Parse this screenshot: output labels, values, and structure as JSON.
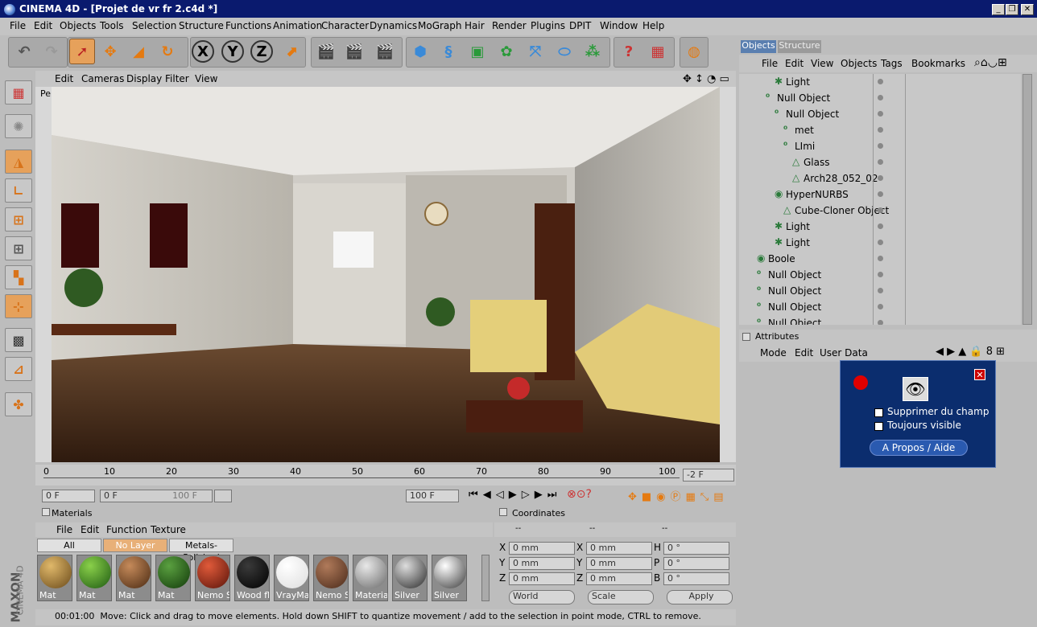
{
  "window": {
    "title": "CINEMA 4D - [Projet de vr fr 2.c4d *]",
    "minimize": "_",
    "restore": "❐",
    "close": "✕"
  },
  "menu": [
    "File",
    "Edit",
    "Objects",
    "Tools",
    "Selection",
    "Structure",
    "Functions",
    "Animation",
    "Character",
    "Dynamics",
    "MoGraph",
    "Hair",
    "Render",
    "Plugins",
    "DPIT",
    "Window",
    "Help"
  ],
  "toolbar": {
    "axis_x": "X",
    "axis_y": "Y",
    "axis_z": "Z"
  },
  "viewport": {
    "menu": [
      "Edit",
      "Cameras",
      "Display",
      "Filter",
      "View"
    ],
    "label": "Pe"
  },
  "timeline": {
    "ticks": [
      "0",
      "10",
      "20",
      "30",
      "40",
      "50",
      "60",
      "70",
      "80",
      "90",
      "100"
    ],
    "current_frame": "-2 F"
  },
  "transport": {
    "start": "0 F",
    "range_start": "0 F",
    "range_end": "100 F",
    "end": "100 F"
  },
  "materials": {
    "title": "Materials",
    "menu": [
      "File",
      "Edit",
      "Function",
      "Texture"
    ],
    "tabs": [
      "All",
      "No Layer",
      "Metals-Polished"
    ],
    "items": [
      {
        "name": "Mat",
        "c1": "#e0b86a",
        "c2": "#6a4a1a"
      },
      {
        "name": "Mat",
        "c1": "#8ad04a",
        "c2": "#1e5a12"
      },
      {
        "name": "Mat",
        "c1": "#c58a5a",
        "c2": "#4a2a12"
      },
      {
        "name": "Mat",
        "c1": "#5aa040",
        "c2": "#123a0a"
      },
      {
        "name": "Nemo Sy",
        "c1": "#e05a3a",
        "c2": "#5a140a"
      },
      {
        "name": "Wood flo",
        "c1": "#3a3a3a",
        "c2": "#000000"
      },
      {
        "name": "VrayMate",
        "c1": "#ffffff",
        "c2": "#dddddd"
      },
      {
        "name": "Nemo Sy",
        "c1": "#b07a5a",
        "c2": "#4a2a1a"
      },
      {
        "name": "Material",
        "c1": "#e8e8e8",
        "c2": "#6a6a6a"
      },
      {
        "name": "Silver",
        "c1": "#dddddd",
        "c2": "#2a2a2a"
      },
      {
        "name": "Silver",
        "c1": "#ffffff",
        "c2": "#3a3a3a"
      }
    ]
  },
  "coordinates": {
    "title": "Coordinates",
    "headers": [
      "--",
      "--",
      "--"
    ],
    "rows": [
      [
        "X",
        "0 mm",
        "X",
        "0 mm",
        "H",
        "0 °"
      ],
      [
        "Y",
        "0 mm",
        "Y",
        "0 mm",
        "P",
        "0 °"
      ],
      [
        "Z",
        "0 mm",
        "Z",
        "0 mm",
        "B",
        "0 °"
      ]
    ],
    "world": "World",
    "scale": "Scale",
    "apply": "Apply"
  },
  "status": {
    "time": "00:01:00",
    "text": "Move: Click and drag to move elements. Hold down SHIFT to quantize movement / add to the selection in point mode, CTRL to remove."
  },
  "branding": {
    "maxon": "MAXON",
    "c4d": "CINEMA 4D"
  },
  "objects_panel": {
    "tabs": [
      "Objects",
      "Structure"
    ],
    "menu": [
      "File",
      "Edit",
      "View",
      "Objects",
      "Tags",
      "Bookmarks"
    ],
    "rows": [
      {
        "name": "Light",
        "indent": 2,
        "icon": "✱"
      },
      {
        "name": "Null Object",
        "indent": 1,
        "icon": "⁰"
      },
      {
        "name": "Null Object",
        "indent": 2,
        "icon": "⁰"
      },
      {
        "name": "met",
        "indent": 3,
        "icon": "⁰"
      },
      {
        "name": "LImi",
        "indent": 3,
        "icon": "⁰"
      },
      {
        "name": "Glass",
        "indent": 4,
        "icon": "△"
      },
      {
        "name": "Arch28_052_02",
        "indent": 4,
        "icon": "△"
      },
      {
        "name": "HyperNURBS",
        "indent": 2,
        "icon": "◉"
      },
      {
        "name": "Cube-Cloner Object",
        "indent": 3,
        "icon": "△"
      },
      {
        "name": "Light",
        "indent": 2,
        "icon": "✱"
      },
      {
        "name": "Light",
        "indent": 2,
        "icon": "✱"
      },
      {
        "name": "Boole",
        "indent": 0,
        "icon": "◉"
      },
      {
        "name": "Null Object",
        "indent": 0,
        "icon": "⁰"
      },
      {
        "name": "Null Object",
        "indent": 0,
        "icon": "⁰"
      },
      {
        "name": "Null Object",
        "indent": 0,
        "icon": "⁰"
      },
      {
        "name": "Null Object",
        "indent": 0,
        "icon": "⁰"
      }
    ]
  },
  "attributes": {
    "title": "Attributes",
    "menu": [
      "Mode",
      "Edit",
      "User Data"
    ]
  },
  "dialog": {
    "opt1": "Supprimer du champ",
    "opt2": "Toujours visible",
    "button": "A Propos / Aide"
  }
}
